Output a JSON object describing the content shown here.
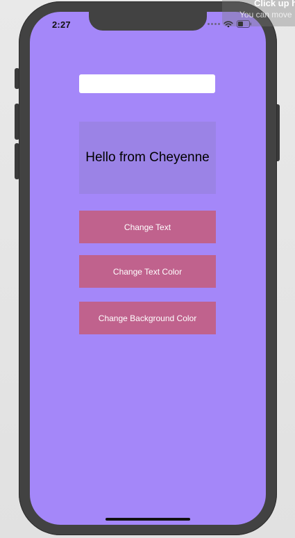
{
  "status_bar": {
    "time": "2:27"
  },
  "text_field": {
    "value": "",
    "placeholder": ""
  },
  "greeting": {
    "text": "Hello from Cheyenne"
  },
  "buttons": {
    "change_text": "Change Text",
    "change_text_color": "Change Text Color",
    "change_background_color": "Change Background Color"
  },
  "overlay": {
    "title": "Click up h",
    "subtitle": "You can move"
  },
  "colors": {
    "screen_background": "#a487f9",
    "greeting_box": "#9b83e6",
    "button_background": "#c0628d",
    "button_text": "#ffffff",
    "device_frame": "#424242"
  },
  "icons": [
    "wifi-icon",
    "battery-icon",
    "signal-dots-icon"
  ]
}
